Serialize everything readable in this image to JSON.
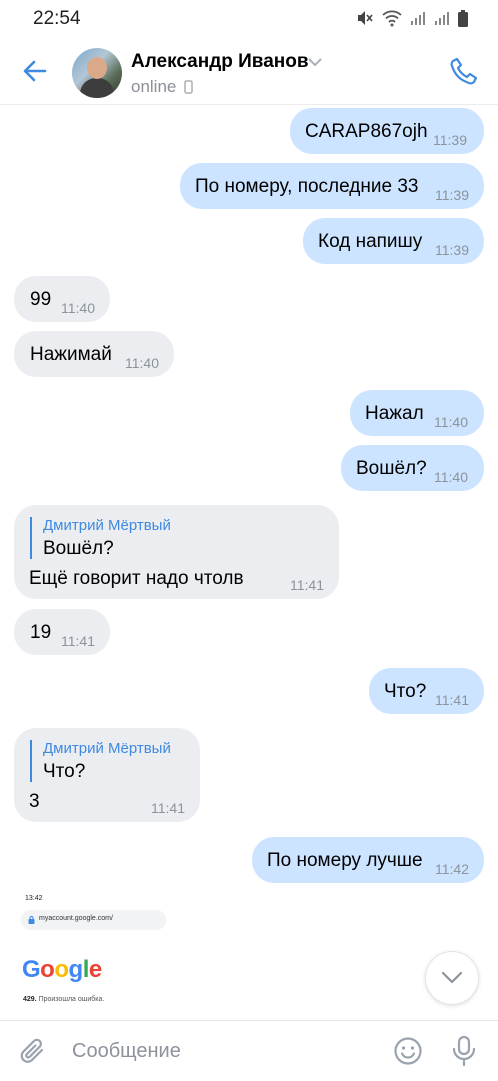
{
  "status_bar": {
    "time": "22:54"
  },
  "header": {
    "contact_name": "Александр Иванов",
    "status": "online"
  },
  "messages": [
    {
      "dir": "out",
      "text": "CARAP867ojh",
      "time": "11:39"
    },
    {
      "dir": "out",
      "text": "По номеру, последние 33",
      "time": "11:39"
    },
    {
      "dir": "out",
      "text": "Код напишу",
      "time": "11:39"
    },
    {
      "dir": "in",
      "text": "99",
      "time": "11:40"
    },
    {
      "dir": "in",
      "text": "Нажимай",
      "time": "11:40"
    },
    {
      "dir": "out",
      "text": "Нажал",
      "time": "11:40"
    },
    {
      "dir": "out",
      "text": "Вошёл?",
      "time": "11:40"
    },
    {
      "dir": "in",
      "reply_author": "Дмитрий Мёртвый",
      "reply_text": "Вошёл?",
      "text": "Ещё говорит надо чтолв",
      "time": "11:41"
    },
    {
      "dir": "in",
      "text": "19",
      "time": "11:41"
    },
    {
      "dir": "out",
      "text": "Что?",
      "time": "11:41"
    },
    {
      "dir": "in",
      "reply_author": "Дмитрий Мёртвый",
      "reply_text": "Что?",
      "text": "3",
      "time": "11:41"
    },
    {
      "dir": "out",
      "text": "По номеру лучше",
      "time": "11:42"
    }
  ],
  "attachment": {
    "time": "13:42",
    "url": "myaccount.google.com/",
    "logo": "Google",
    "error_code": "429.",
    "error_text": "Произошла ошибка."
  },
  "composer": {
    "placeholder": "Сообщение"
  },
  "colors": {
    "accent": "#3f8ae0",
    "outgoing_bubble": "#cce4ff",
    "incoming_bubble": "#ebedf0",
    "time_text": "#8c939b"
  },
  "icons": [
    "back-arrow-icon",
    "chevron-down-icon",
    "phone-icon",
    "mobile-icon",
    "paperclip-icon",
    "smile-icon",
    "microphone-icon",
    "chevron-down-circle-icon"
  ]
}
